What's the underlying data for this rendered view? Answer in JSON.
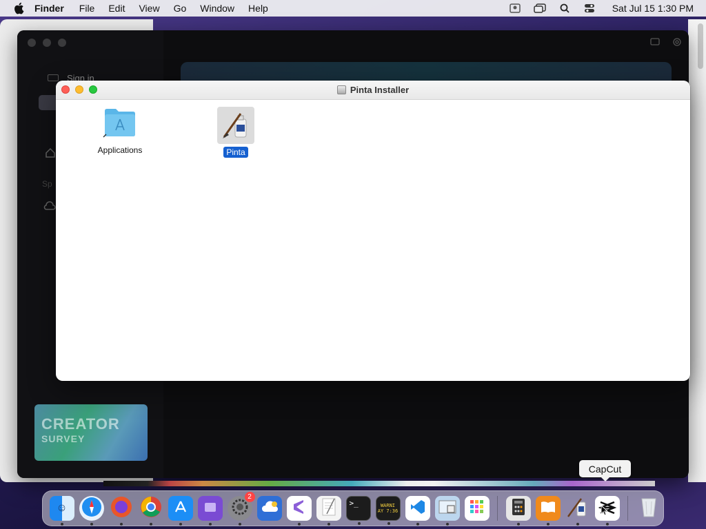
{
  "menubar": {
    "app_name": "Finder",
    "items": [
      "File",
      "Edit",
      "View",
      "Go",
      "Window",
      "Help"
    ],
    "clock": "Sat Jul 15  1:30 PM"
  },
  "capcut": {
    "signin": "Sign in",
    "space_label": "Sp",
    "promo_line1": "CREATOR",
    "promo_line2": "SURVEY"
  },
  "installer": {
    "title": "Pinta Installer",
    "items": [
      {
        "label": "Applications",
        "icon": "applications-folder-icon",
        "selected": false
      },
      {
        "label": "Pinta",
        "icon": "pinta-app-icon",
        "selected": true
      }
    ]
  },
  "dock": {
    "items": [
      {
        "name": "finder",
        "color": "#2a8df0"
      },
      {
        "name": "safari",
        "color": "#1f8ef1"
      },
      {
        "name": "firefox",
        "color": "#e8562a"
      },
      {
        "name": "chrome",
        "color": "#ffffff"
      },
      {
        "name": "app-store",
        "color": "#1c8ef6"
      },
      {
        "name": "pockity",
        "color": "#7a4bd3"
      },
      {
        "name": "system-settings",
        "color": "#8a8a8e",
        "badge": "2"
      },
      {
        "name": "cloudmounter",
        "color": "#2f6fd6"
      },
      {
        "name": "visual-studio",
        "color": "#ffffff"
      },
      {
        "name": "textedit",
        "color": "#f4f4f4"
      },
      {
        "name": "terminal",
        "color": "#1c1c1c"
      },
      {
        "name": "console",
        "color": "#1c1c1c",
        "text": "WARNI\nAY 7:36"
      },
      {
        "name": "vscode",
        "color": "#ffffff"
      },
      {
        "name": "preview",
        "color": "#bcd6ee"
      },
      {
        "name": "launchpad",
        "color": "#ffffff"
      },
      {
        "name": "calculator",
        "color": "#e6e6e6"
      },
      {
        "name": "books",
        "color": "#f08a1c"
      },
      {
        "name": "pinta",
        "color": "#e0e0e0"
      },
      {
        "name": "capcut",
        "color": "#ffffff"
      },
      {
        "name": "trash",
        "color": "#dfe3e6"
      }
    ],
    "tooltip": "CapCut"
  }
}
